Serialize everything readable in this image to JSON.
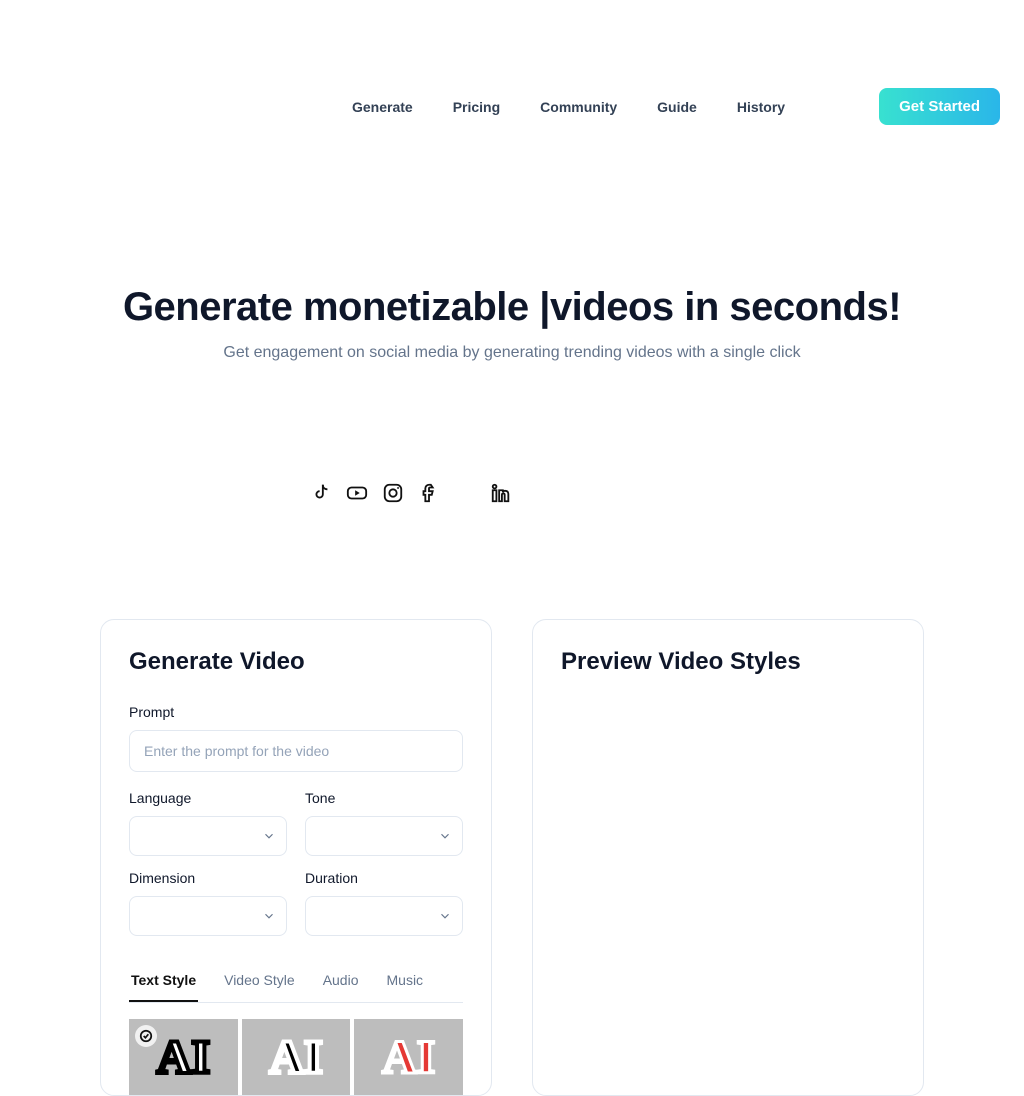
{
  "nav": {
    "links": [
      "Generate",
      "Pricing",
      "Community",
      "Guide",
      "History"
    ],
    "cta": "Get Started"
  },
  "hero": {
    "title_part1": "Generate monetizable ",
    "title_cursor": "|",
    "title_part2": "videos in seconds!",
    "subtitle": "Get engagement on social media by generating trending videos with a single click"
  },
  "social_icons": [
    "tiktok",
    "youtube",
    "instagram",
    "facebook",
    "",
    "linkedin"
  ],
  "panel_left": {
    "title": "Generate Video",
    "prompt_label": "Prompt",
    "prompt_placeholder": "Enter the prompt for the video",
    "language_label": "Language",
    "tone_label": "Tone",
    "dimension_label": "Dimension",
    "duration_label": "Duration",
    "tabs": [
      "Text Style",
      "Video Style",
      "Audio",
      "Music"
    ],
    "active_tab": "Text Style",
    "thumbs": [
      {
        "text": "AI",
        "variant": "white",
        "selected": true
      },
      {
        "text": "AI",
        "variant": "black",
        "selected": false
      },
      {
        "text": "AI",
        "variant": "red",
        "selected": false
      }
    ]
  },
  "panel_right": {
    "title": "Preview Video Styles"
  }
}
